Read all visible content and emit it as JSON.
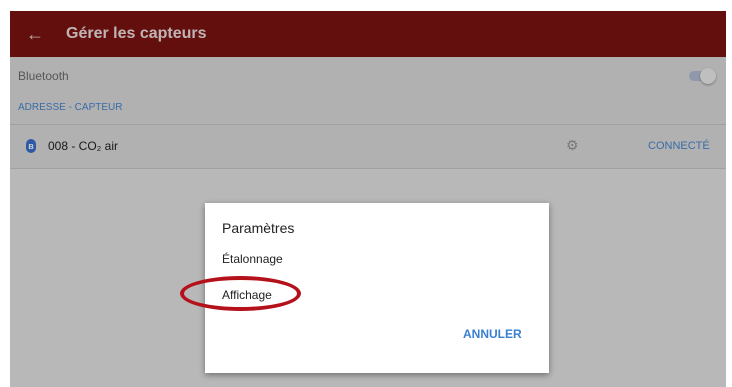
{
  "appbar": {
    "title": "Gérer les capteurs",
    "back_icon": "←"
  },
  "bluetooth": {
    "label": "Bluetooth",
    "toggle_on": true
  },
  "section": {
    "header": "ADRESSE - CAPTEUR"
  },
  "sensor": {
    "name": "008 - CO₂ air",
    "status": "CONNECTÉ",
    "icon": "bluetooth-icon"
  },
  "dialog": {
    "title": "Paramètres",
    "options": [
      "Étalonnage",
      "Affichage"
    ],
    "cancel_label": "ANNULER"
  },
  "colors": {
    "appbar": "#7f1413",
    "accent": "#4a8bd6",
    "highlight_ring": "#b5111a"
  }
}
